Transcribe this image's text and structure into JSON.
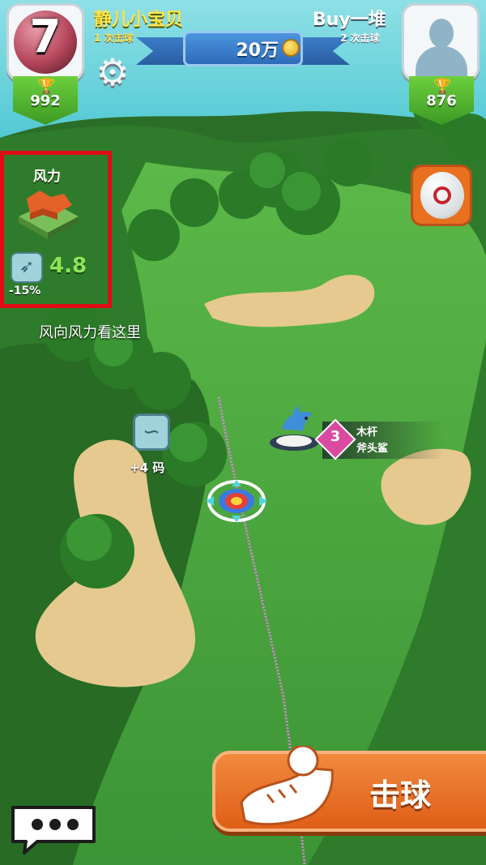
{
  "hud": {
    "hole_number": "7",
    "left_player": {
      "name": "静儿小宝贝",
      "strokes": "1 次击球",
      "trophies": "992"
    },
    "right_player": {
      "name": "Buy一堆",
      "strokes": "2 次击球",
      "trophies": "876"
    },
    "pot": "20万"
  },
  "wind": {
    "title": "风力",
    "speed": "4.8",
    "modifier": "-15%",
    "caption": "风向风力看这里"
  },
  "course": {
    "bounce_bonus": "+4 码",
    "club": {
      "level": "3",
      "name": "木杆",
      "model": "斧头鲨"
    }
  },
  "actions": {
    "shoot": "击球"
  },
  "colors": {
    "highlight_border": "#e10b15",
    "fairway": "#3f9a36",
    "sand": "#e5c98f",
    "water": "#5ad7e0",
    "shoot_button": "#e8701f"
  }
}
